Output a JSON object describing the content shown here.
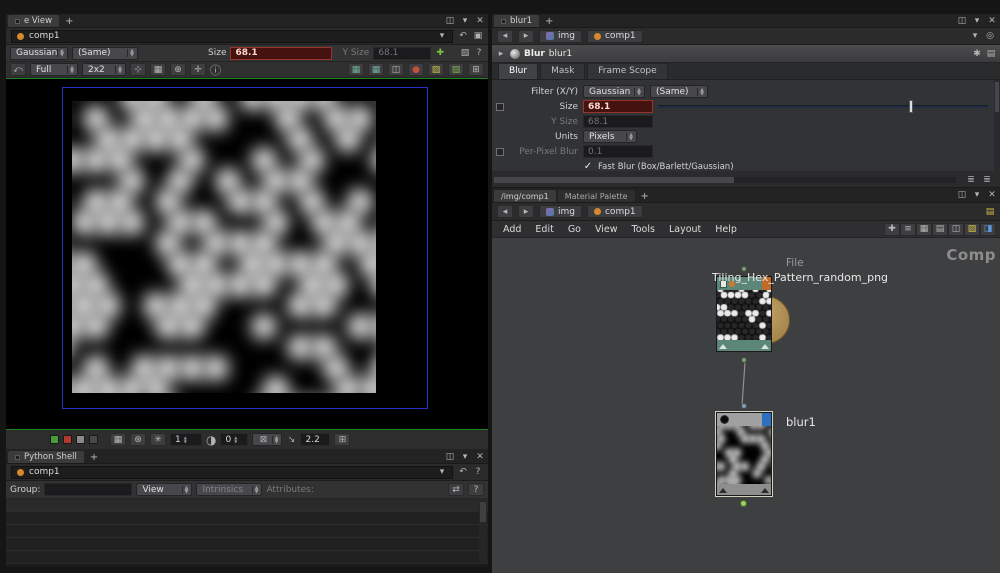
{
  "left_pane": {
    "viewer_tab_label": "e View",
    "context_path": "comp1",
    "toolbar": {
      "filter_value": "Gaussian",
      "filter_same_value": "(Same)",
      "size_label": "Size",
      "size_value": "68.1",
      "y_size_label": "Y Size",
      "y_size_value": "68.1",
      "view_mode_value": "Full",
      "split_value": "2x2"
    },
    "view_footer": {
      "gain_value": "1",
      "offset_value": "0",
      "zoom_value": "2.2"
    },
    "shell_tab_label": "Python Shell",
    "context_path2": "comp1",
    "spreadsheet_bar": {
      "group_label": "Group:",
      "view_value": "View",
      "intrinsics_value": "Intrinsics",
      "attributes_label": "Attributes:"
    }
  },
  "right_pane": {
    "tab_label": "blur1",
    "breadcrumb": {
      "network": "img",
      "node": "comp1"
    },
    "node_header": {
      "type_label": "Blur",
      "name_value": "blur1"
    },
    "param_tabs": [
      "Blur",
      "Mask",
      "Frame Scope"
    ],
    "params": {
      "filter_label": "Filter (X/Y)",
      "filter_value": "Gaussian",
      "filter_same_value": "(Same)",
      "size_label": "Size",
      "size_value": "68.1",
      "y_size_label": "Y Size",
      "y_size_value": "68.1",
      "units_label": "Units",
      "units_value": "Pixels",
      "per_pixel_label": "Per-Pixel Blur",
      "per_pixel_value": "0.1",
      "fast_blur_label": "Fast Blur (Box/Barlett/Gaussian)"
    },
    "network_pane": {
      "tab_path": "/img/comp1",
      "tab_palette": "Material Palette",
      "breadcrumb": {
        "network": "img",
        "node": "comp1"
      },
      "menus": [
        "Add",
        "Edit",
        "Go",
        "View",
        "Tools",
        "Layout",
        "Help"
      ],
      "context_label": "Comp",
      "file_node": {
        "type_label": "File",
        "name": "Tiling_Hex_Pattern_random_png"
      },
      "blur_node": {
        "name": "blur1"
      }
    }
  },
  "colors": {
    "accent_orange": "#d8882a",
    "flag_orange": "#c06a28",
    "flag_blue": "#2f6fc2",
    "alert_field_bg": "#441310",
    "alert_field_border": "#99342c",
    "node_teal": "#5c8677",
    "viewport_green": "#1c861c",
    "frame_blue": "#2531c8",
    "badge_tan": "#b5935a",
    "wire_gray": "#909090"
  }
}
